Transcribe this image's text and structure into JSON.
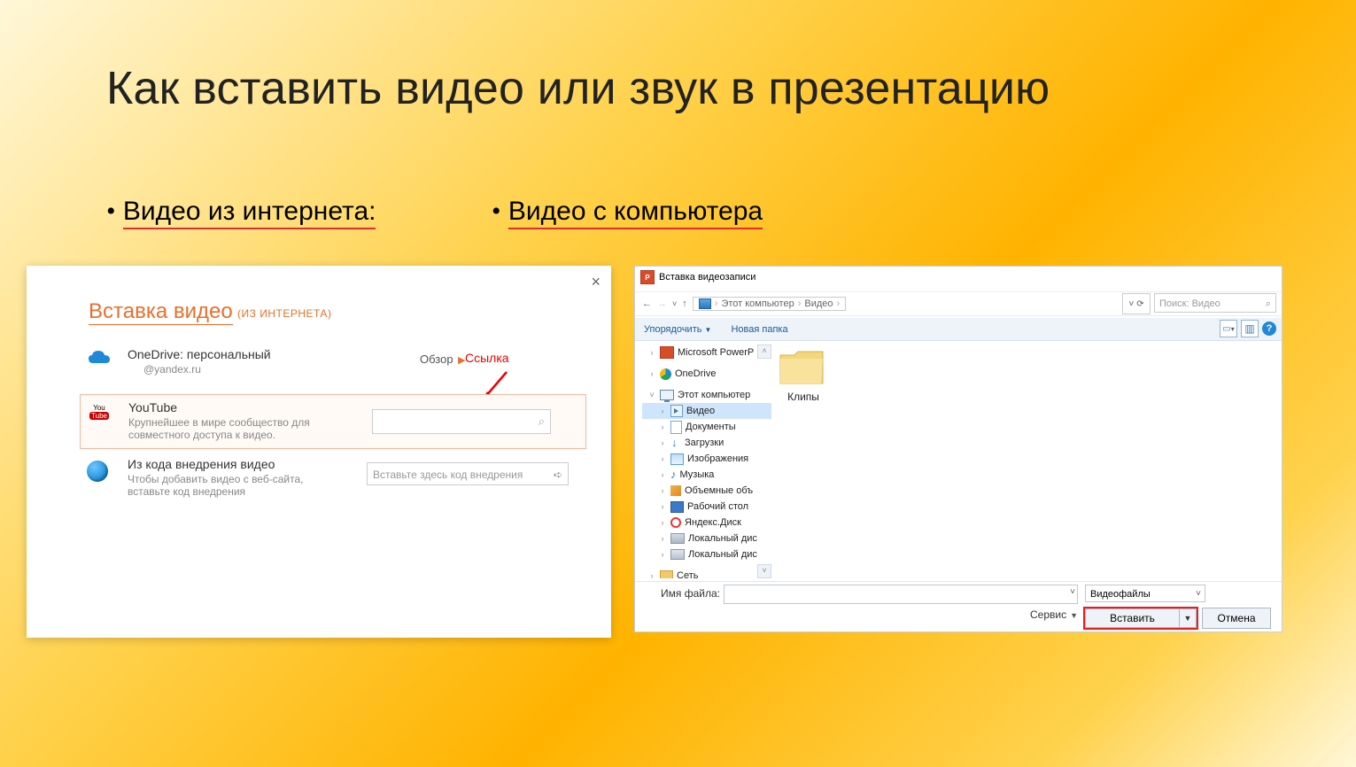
{
  "title": "Как вставить видео или звук в презентацию",
  "bulletLeft": "Видео из интернета:",
  "bulletRight": "Видео  с компьютера",
  "panelLeft": {
    "heading": "Вставка видео",
    "subheading": "(ИЗ ИНТЕРНЕТА)",
    "close": "×",
    "linkLabel": "Ссылка",
    "onedrive": {
      "title": "OneDrive: персональный",
      "subtitle": "@yandex.ru",
      "browse": "Обзор"
    },
    "youtube": {
      "title": "YouTube",
      "subtitle": "Крупнейшее в мире сообщество для совместного доступа к видео."
    },
    "embed": {
      "title": "Из кода внедрения видео",
      "subtitle": "Чтобы добавить видео с веб-сайта, вставьте код внедрения",
      "placeholder": "Вставьте здесь код внедрения"
    }
  },
  "panelRight": {
    "windowTitle": "Вставка видеозаписи",
    "crumb1": "Этот компьютер",
    "crumb2": "Видео",
    "searchPlaceholder": "Поиск: Видео",
    "organize": "Упорядочить",
    "newFolder": "Новая папка",
    "folderItem": "Клипы",
    "tree": {
      "powerp": "Microsoft PowerP",
      "onedrive": "OneDrive",
      "thispc": "Этот компьютер",
      "video": "Видео",
      "docs": "Документы",
      "downloads": "Загрузки",
      "images": "Изображения",
      "music": "Музыка",
      "objects": "Объемные объ",
      "desktop": "Рабочий стол",
      "yadisk": "Яндекс.Диск",
      "disk1": "Локальный дис",
      "disk2": "Локальный дис",
      "network": "Сеть"
    },
    "fileLabel": "Имя файла:",
    "typeFilter": "Видеофайлы",
    "tools": "Сервис",
    "insert": "Вставить",
    "cancel": "Отмена"
  }
}
